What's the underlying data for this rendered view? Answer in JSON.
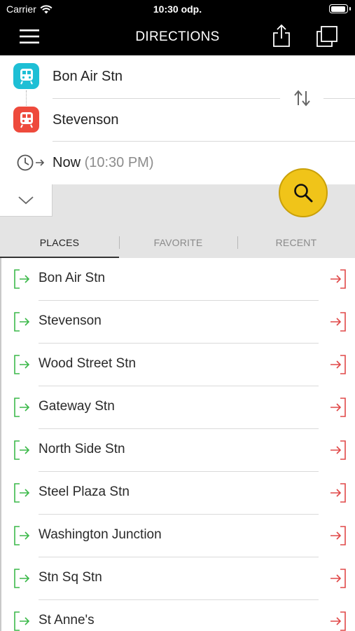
{
  "status_bar": {
    "carrier": "Carrier",
    "time": "10:30 odp.",
    "battery_icon": "battery-icon",
    "wifi_icon": "wifi-icon"
  },
  "nav": {
    "title": "DIRECTIONS",
    "menu_icon": "hamburger-menu-icon",
    "share_icon": "share-icon",
    "copy_icon": "copy-icon"
  },
  "route": {
    "from": "Bon Air Stn",
    "to": "Stevenson",
    "time_label": "Now",
    "time_value": "(10:30 PM)",
    "from_color": "#1ebfd5",
    "to_color": "#ee4a3c",
    "swap_icon": "swap-icon",
    "clock_icon": "clock-arrow-icon"
  },
  "search_button": {
    "icon": "search-icon",
    "color": "#f0c419"
  },
  "tabs": [
    {
      "label": "PLACES",
      "active": true
    },
    {
      "label": "FAVORITE",
      "active": false
    },
    {
      "label": "RECENT",
      "active": false
    }
  ],
  "places": [
    {
      "name": "Bon Air Stn"
    },
    {
      "name": "Stevenson"
    },
    {
      "name": "Wood Street Stn"
    },
    {
      "name": "Gateway Stn"
    },
    {
      "name": "North Side Stn"
    },
    {
      "name": "Steel Plaza Stn"
    },
    {
      "name": "Washington Junction"
    },
    {
      "name": "Stn Sq Stn"
    },
    {
      "name": "St Anne's"
    }
  ],
  "list_icons": {
    "set_origin": "enter-origin-icon",
    "set_destination": "exit-destination-icon",
    "origin_color": "#3cb94a",
    "destination_color": "#e04848"
  }
}
